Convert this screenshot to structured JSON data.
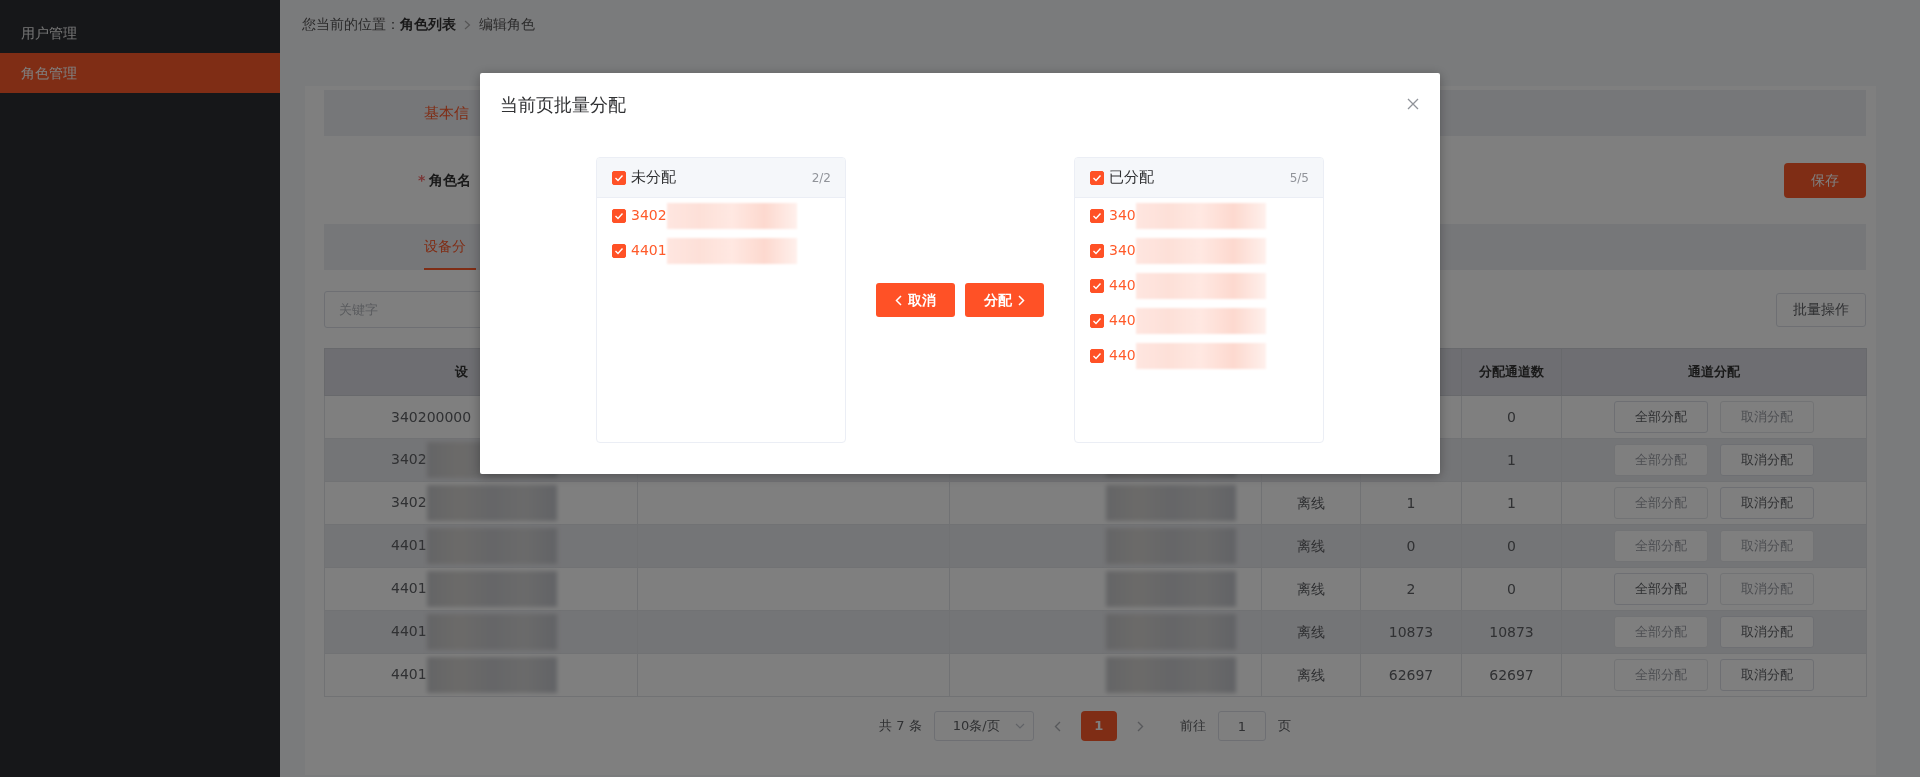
{
  "sidebar": {
    "items": [
      {
        "label": "用户管理",
        "selected": false
      },
      {
        "label": "角色管理",
        "selected": true
      }
    ]
  },
  "breadcrumb": {
    "prefix": "您当前的位置：",
    "items": [
      {
        "label": "角色列表",
        "current": false
      },
      {
        "label": "编辑角色",
        "current": true
      }
    ]
  },
  "basic_info": {
    "title": "基本信",
    "role_name_label": "角色名",
    "required_mark": "*",
    "save_button": "保存"
  },
  "tabs": [
    {
      "label": "设备分",
      "selected": true
    }
  ],
  "search": {
    "placeholder": "关键字"
  },
  "batch_button": "批量操作",
  "table": {
    "columns": [
      {
        "label": "设"
      },
      {},
      {},
      {},
      {},
      {
        "label": "分配通道数"
      },
      {
        "label": "通道分配"
      }
    ],
    "rows": [
      {
        "cells": [
          "340200000",
          null,
          null,
          null,
          null,
          "0"
        ],
        "blurred": false,
        "assign_all": {
          "label": "全部分配",
          "disabled": false
        },
        "unassign": {
          "label": "取消分配",
          "disabled": true
        }
      },
      {
        "cells": [
          "3402",
          null,
          null,
          null,
          null,
          "1"
        ],
        "blurred": true,
        "assign_all": {
          "label": "全部分配",
          "disabled": true
        },
        "unassign": {
          "label": "取消分配",
          "disabled": false
        }
      },
      {
        "cells": [
          "3402",
          null,
          null,
          "离线",
          "1",
          "1"
        ],
        "blurred": true,
        "assign_all": {
          "label": "全部分配",
          "disabled": true
        },
        "unassign": {
          "label": "取消分配",
          "disabled": false
        }
      },
      {
        "cells": [
          "4401",
          null,
          null,
          "离线",
          "0",
          "0"
        ],
        "blurred": true,
        "assign_all": {
          "label": "全部分配",
          "disabled": true
        },
        "unassign": {
          "label": "取消分配",
          "disabled": true
        }
      },
      {
        "cells": [
          "4401",
          null,
          null,
          "离线",
          "2",
          "0"
        ],
        "blurred": true,
        "assign_all": {
          "label": "全部分配",
          "disabled": false
        },
        "unassign": {
          "label": "取消分配",
          "disabled": true
        }
      },
      {
        "cells": [
          "4401",
          null,
          null,
          "离线",
          "10873",
          "10873"
        ],
        "blurred": true,
        "assign_all": {
          "label": "全部分配",
          "disabled": true
        },
        "unassign": {
          "label": "取消分配",
          "disabled": false
        }
      },
      {
        "cells": [
          "4401",
          null,
          null,
          "离线",
          "62697",
          "62697"
        ],
        "blurred": true,
        "assign_all": {
          "label": "全部分配",
          "disabled": true
        },
        "unassign": {
          "label": "取消分配",
          "disabled": false
        }
      }
    ]
  },
  "pagination": {
    "total": "共 7 条",
    "page_size": "10条/页",
    "pages": [
      {
        "label": "1",
        "selected": true
      }
    ],
    "goto_label": "前往",
    "goto_value": "1",
    "goto_suffix": "页"
  },
  "modal": {
    "title": "当前页批量分配",
    "panels": [
      {
        "title": "未分配",
        "count": "2/2",
        "checked": true,
        "items": [
          {
            "label": "3402",
            "checked": true
          },
          {
            "label": "4401",
            "checked": true
          }
        ]
      },
      {
        "title": "已分配",
        "count": "5/5",
        "checked": true,
        "items": [
          {
            "label": "340",
            "checked": true
          },
          {
            "label": "340",
            "checked": true
          },
          {
            "label": "440",
            "checked": true
          },
          {
            "label": "440",
            "checked": true
          },
          {
            "label": "440",
            "checked": true
          }
        ]
      }
    ],
    "buttons": [
      {
        "label": "取消",
        "kind": "back"
      },
      {
        "label": "分配",
        "kind": "forward"
      }
    ]
  }
}
